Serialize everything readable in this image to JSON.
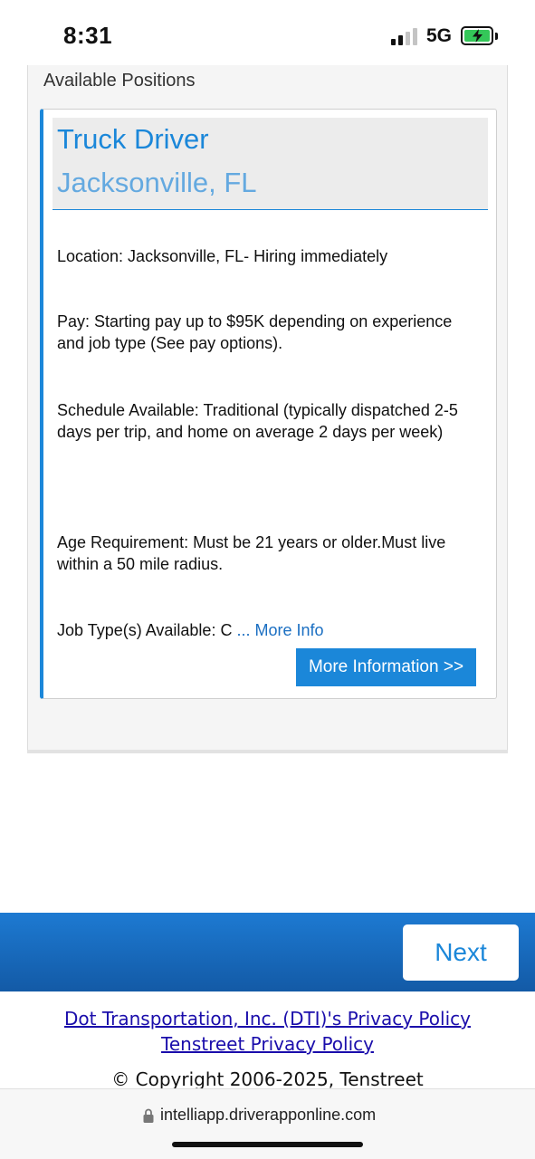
{
  "status_bar": {
    "time": "8:31",
    "network": "5G",
    "battery_color": "#34c759"
  },
  "section": {
    "heading": "Available Positions"
  },
  "job": {
    "title": "Truck Driver",
    "location": "Jacksonville, FL",
    "details": [
      "Location: Jacksonville, FL- Hiring immediately",
      "Pay: Starting pay up to $95K depending on experience and job type (See pay options).",
      "Schedule Available: Traditional (typically dispatched 2-5 days per trip, and home on average 2 days per week)",
      "Age Requirement: Must be 21 years or older.Must live within a 50 mile radius."
    ],
    "job_type_prefix": "Job Type(s) Available: C ",
    "more_info_link": "... More Info",
    "more_info_button": "More Information >>"
  },
  "footer": {
    "next_label": "Next",
    "privacy_company": "Dot Transportation, Inc. (DTI)'s Privacy Policy",
    "privacy_tenstreet": "Tenstreet Privacy Policy",
    "copyright": "© Copyright 2006-2025, Tenstreet"
  },
  "browser": {
    "url": "intelliapp.driverapponline.com"
  },
  "colors": {
    "accent": "#1b87d9",
    "location": "#64a9e0",
    "footer_bar": "#1d7ad2",
    "link": "#1a0dab"
  }
}
